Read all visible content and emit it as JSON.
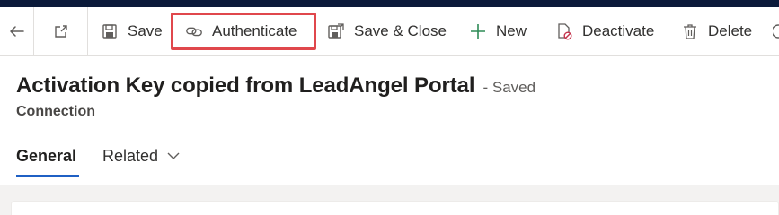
{
  "toolbar": {
    "back_icon": "arrow-left-icon",
    "popout_icon": "open-in-new-window-icon",
    "commands": {
      "save": "Save",
      "authenticate": "Authenticate",
      "save_close": "Save & Close",
      "new": "New",
      "deactivate": "Deactivate",
      "delete": "Delete"
    },
    "highlighted_command": "Authenticate",
    "highlight_color": "#e0474c"
  },
  "record": {
    "title": "Activation Key copied from LeadAngel Portal",
    "status": "- Saved",
    "entity": "Connection"
  },
  "tabs": {
    "general": "General",
    "related": "Related",
    "active": "General",
    "accent_color": "#1f60c4"
  }
}
